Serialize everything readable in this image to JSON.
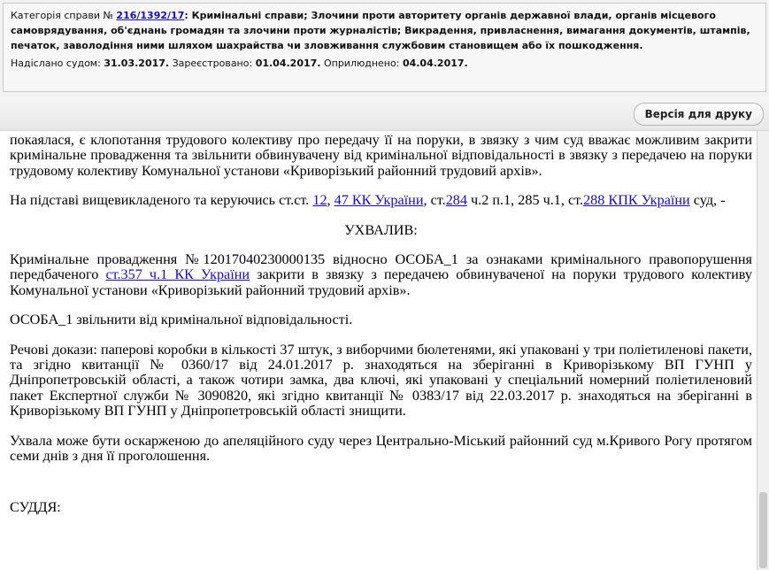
{
  "header": {
    "category_label": "Категорія справи № ",
    "case_number": "216/1392/17",
    "category_text": ": Кримінальні справи; Злочини проти авторитету органів державної влади, органів місцевого самоврядування, об'єднань громадян та злочини проти журналістів; Викрадення, привласнення, вимагання документів, штампів, печаток, заволодіння ними шляхом шахрайства чи зловживання службовим становищем або їх пошкодження.",
    "sent_label": "Надіслано судом: ",
    "sent_date": "31.03.2017.",
    "registered_label": " Зареєстровано: ",
    "registered_date": "01.04.2017.",
    "published_label": " Оприлюднено: ",
    "published_date": "04.04.2017."
  },
  "toolbar": {
    "print_label": "Версія для друку"
  },
  "document": {
    "p1": "покаялася, є клопотання трудового колективу про передачу її на поруки, в звязку з чим суд вважає можливим закрити кримінальне провадження та звільнити обвинувачену від кримінальної відповідальності в звязку з передачею на поруки трудовому колективу Комунальної установи «Криворізький районний трудовий архів».",
    "p2_a": "На підставі вищевикладеного та керуючись ст.ст. ",
    "p2_link1": "12",
    "p2_b": ", ",
    "p2_link2": "47 КК України",
    "p2_c": ", ст.",
    "p2_link3": "284",
    "p2_d": " ч.2 п.1, 285 ч.1, ст.",
    "p2_link4": "288 КПК України",
    "p2_e": " суд, -",
    "heading": "УХВАЛИВ:",
    "p3_a": "Кримінальне провадження №12017040230000135 відносно ОСОБА_1 за ознаками кримінального правопорушення передбаченого ",
    "p3_link": "ст.357 ч.1 КК України",
    "p3_b": " закрити в звязку з передачею обвинуваченої на поруки трудового колективу Комунальної установи «Криворізький районний трудовий архів».",
    "p4": "ОСОБА_1 звільнити від кримінальної відповідальності.",
    "p5": "Речові докази: паперові коробки в кількості 37 штук, з виборчими бюлетенями, які упаковані у три поліетиленові пакети, та згідно квитанції № 0360/17 від 24.01.2017 р. знаходяться на зберіганні в Криворізькому ВП ГУНП у Дніпропетровській області, а також чотири замка, два ключі, які упаковані у спеціальний номерний поліетиленовий пакет Експертної служби № 3090820, які згідно квитанції № 0383/17 від 22.03.2017 р. знаходяться на зберіганні в Криворізькому ВП ГУНП у Дніпропетровській області знищити.",
    "p6": "Ухвала може бути оскарженою до апеляційного суду через Центрально-Міський районний суд м.Кривого Рогу протягом семи днів з дня її проголошення.",
    "judge": "СУДДЯ:"
  }
}
